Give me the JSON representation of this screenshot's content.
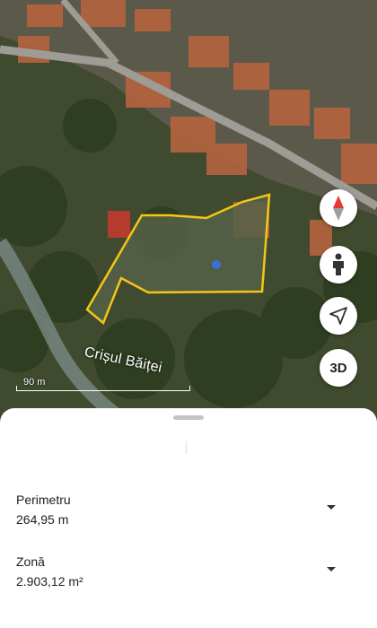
{
  "map": {
    "river_label": "Crișul Băiței",
    "scale_label": "90 m",
    "polygon_color": "#f5c518"
  },
  "controls": {
    "compass_icon": "compass-icon",
    "street_view_icon": "person-icon",
    "locate_icon": "location-arrow-icon",
    "threed_label": "3D"
  },
  "measurements": [
    {
      "label": "Perimetru",
      "value": "264,95 m"
    },
    {
      "label": "Zonă",
      "value": "2.903,12 m²"
    }
  ]
}
